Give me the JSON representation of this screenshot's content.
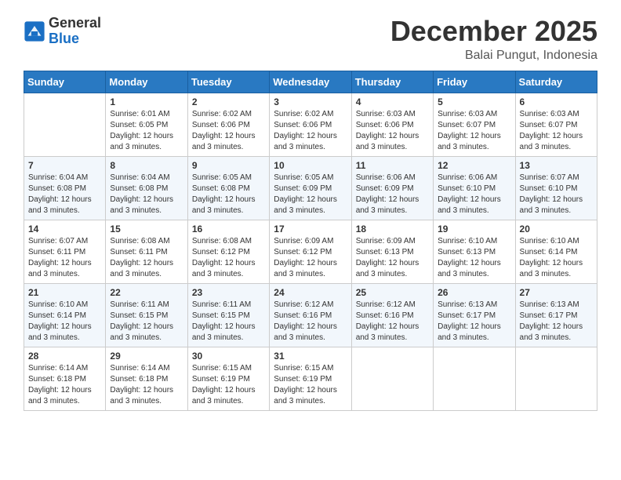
{
  "header": {
    "logo_line1": "General",
    "logo_line2": "Blue",
    "month": "December 2025",
    "location": "Balai Pungut, Indonesia"
  },
  "days_of_week": [
    "Sunday",
    "Monday",
    "Tuesday",
    "Wednesday",
    "Thursday",
    "Friday",
    "Saturday"
  ],
  "weeks": [
    [
      {
        "empty": true
      },
      {
        "day": "1",
        "sunrise": "Sunrise: 6:01 AM",
        "sunset": "Sunset: 6:05 PM",
        "daylight": "Daylight: 12 hours and 3 minutes."
      },
      {
        "day": "2",
        "sunrise": "Sunrise: 6:02 AM",
        "sunset": "Sunset: 6:06 PM",
        "daylight": "Daylight: 12 hours and 3 minutes."
      },
      {
        "day": "3",
        "sunrise": "Sunrise: 6:02 AM",
        "sunset": "Sunset: 6:06 PM",
        "daylight": "Daylight: 12 hours and 3 minutes."
      },
      {
        "day": "4",
        "sunrise": "Sunrise: 6:03 AM",
        "sunset": "Sunset: 6:06 PM",
        "daylight": "Daylight: 12 hours and 3 minutes."
      },
      {
        "day": "5",
        "sunrise": "Sunrise: 6:03 AM",
        "sunset": "Sunset: 6:07 PM",
        "daylight": "Daylight: 12 hours and 3 minutes."
      },
      {
        "day": "6",
        "sunrise": "Sunrise: 6:03 AM",
        "sunset": "Sunset: 6:07 PM",
        "daylight": "Daylight: 12 hours and 3 minutes."
      }
    ],
    [
      {
        "day": "7",
        "sunrise": "Sunrise: 6:04 AM",
        "sunset": "Sunset: 6:08 PM",
        "daylight": "Daylight: 12 hours and 3 minutes."
      },
      {
        "day": "8",
        "sunrise": "Sunrise: 6:04 AM",
        "sunset": "Sunset: 6:08 PM",
        "daylight": "Daylight: 12 hours and 3 minutes."
      },
      {
        "day": "9",
        "sunrise": "Sunrise: 6:05 AM",
        "sunset": "Sunset: 6:08 PM",
        "daylight": "Daylight: 12 hours and 3 minutes."
      },
      {
        "day": "10",
        "sunrise": "Sunrise: 6:05 AM",
        "sunset": "Sunset: 6:09 PM",
        "daylight": "Daylight: 12 hours and 3 minutes."
      },
      {
        "day": "11",
        "sunrise": "Sunrise: 6:06 AM",
        "sunset": "Sunset: 6:09 PM",
        "daylight": "Daylight: 12 hours and 3 minutes."
      },
      {
        "day": "12",
        "sunrise": "Sunrise: 6:06 AM",
        "sunset": "Sunset: 6:10 PM",
        "daylight": "Daylight: 12 hours and 3 minutes."
      },
      {
        "day": "13",
        "sunrise": "Sunrise: 6:07 AM",
        "sunset": "Sunset: 6:10 PM",
        "daylight": "Daylight: 12 hours and 3 minutes."
      }
    ],
    [
      {
        "day": "14",
        "sunrise": "Sunrise: 6:07 AM",
        "sunset": "Sunset: 6:11 PM",
        "daylight": "Daylight: 12 hours and 3 minutes."
      },
      {
        "day": "15",
        "sunrise": "Sunrise: 6:08 AM",
        "sunset": "Sunset: 6:11 PM",
        "daylight": "Daylight: 12 hours and 3 minutes."
      },
      {
        "day": "16",
        "sunrise": "Sunrise: 6:08 AM",
        "sunset": "Sunset: 6:12 PM",
        "daylight": "Daylight: 12 hours and 3 minutes."
      },
      {
        "day": "17",
        "sunrise": "Sunrise: 6:09 AM",
        "sunset": "Sunset: 6:12 PM",
        "daylight": "Daylight: 12 hours and 3 minutes."
      },
      {
        "day": "18",
        "sunrise": "Sunrise: 6:09 AM",
        "sunset": "Sunset: 6:13 PM",
        "daylight": "Daylight: 12 hours and 3 minutes."
      },
      {
        "day": "19",
        "sunrise": "Sunrise: 6:10 AM",
        "sunset": "Sunset: 6:13 PM",
        "daylight": "Daylight: 12 hours and 3 minutes."
      },
      {
        "day": "20",
        "sunrise": "Sunrise: 6:10 AM",
        "sunset": "Sunset: 6:14 PM",
        "daylight": "Daylight: 12 hours and 3 minutes."
      }
    ],
    [
      {
        "day": "21",
        "sunrise": "Sunrise: 6:10 AM",
        "sunset": "Sunset: 6:14 PM",
        "daylight": "Daylight: 12 hours and 3 minutes."
      },
      {
        "day": "22",
        "sunrise": "Sunrise: 6:11 AM",
        "sunset": "Sunset: 6:15 PM",
        "daylight": "Daylight: 12 hours and 3 minutes."
      },
      {
        "day": "23",
        "sunrise": "Sunrise: 6:11 AM",
        "sunset": "Sunset: 6:15 PM",
        "daylight": "Daylight: 12 hours and 3 minutes."
      },
      {
        "day": "24",
        "sunrise": "Sunrise: 6:12 AM",
        "sunset": "Sunset: 6:16 PM",
        "daylight": "Daylight: 12 hours and 3 minutes."
      },
      {
        "day": "25",
        "sunrise": "Sunrise: 6:12 AM",
        "sunset": "Sunset: 6:16 PM",
        "daylight": "Daylight: 12 hours and 3 minutes."
      },
      {
        "day": "26",
        "sunrise": "Sunrise: 6:13 AM",
        "sunset": "Sunset: 6:17 PM",
        "daylight": "Daylight: 12 hours and 3 minutes."
      },
      {
        "day": "27",
        "sunrise": "Sunrise: 6:13 AM",
        "sunset": "Sunset: 6:17 PM",
        "daylight": "Daylight: 12 hours and 3 minutes."
      }
    ],
    [
      {
        "day": "28",
        "sunrise": "Sunrise: 6:14 AM",
        "sunset": "Sunset: 6:18 PM",
        "daylight": "Daylight: 12 hours and 3 minutes."
      },
      {
        "day": "29",
        "sunrise": "Sunrise: 6:14 AM",
        "sunset": "Sunset: 6:18 PM",
        "daylight": "Daylight: 12 hours and 3 minutes."
      },
      {
        "day": "30",
        "sunrise": "Sunrise: 6:15 AM",
        "sunset": "Sunset: 6:19 PM",
        "daylight": "Daylight: 12 hours and 3 minutes."
      },
      {
        "day": "31",
        "sunrise": "Sunrise: 6:15 AM",
        "sunset": "Sunset: 6:19 PM",
        "daylight": "Daylight: 12 hours and 3 minutes."
      },
      {
        "empty": true
      },
      {
        "empty": true
      },
      {
        "empty": true
      }
    ]
  ]
}
